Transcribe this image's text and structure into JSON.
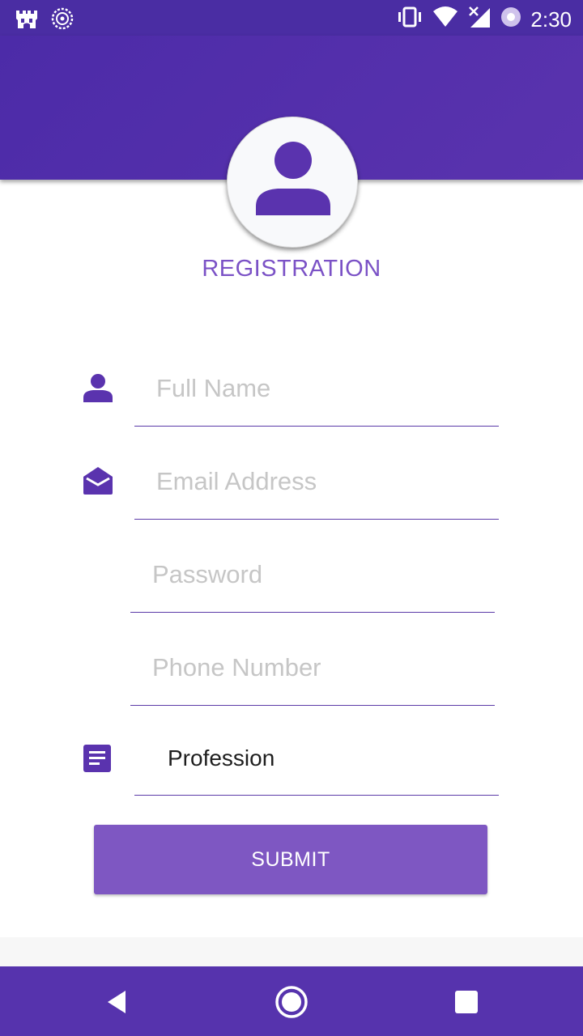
{
  "status_bar": {
    "time": "2:30",
    "left_icons": [
      "castle-notification-icon",
      "spiral-notification-icon"
    ],
    "right_icons": [
      "vibrate-icon",
      "wifi-icon",
      "no-signal-icon",
      "record-icon"
    ]
  },
  "header": {
    "avatar_icon": "person-icon",
    "title": "REGISTRATION"
  },
  "form": {
    "full_name": {
      "placeholder": "Full Name",
      "icon": "person-icon"
    },
    "email": {
      "placeholder": "Email Address",
      "icon": "open-mail-icon"
    },
    "password": {
      "placeholder": "Password"
    },
    "phone": {
      "placeholder": "Phone Number"
    },
    "profession": {
      "value": "Profession",
      "icon": "document-icon"
    },
    "submit_label": "SUBMIT"
  },
  "nav_bar": {
    "buttons": [
      "back-icon",
      "home-icon",
      "recents-icon"
    ]
  },
  "colors": {
    "primary": "#5633ad",
    "accent": "#7e57c2",
    "title": "#7b52c6",
    "placeholder": "#c6c6c6"
  }
}
